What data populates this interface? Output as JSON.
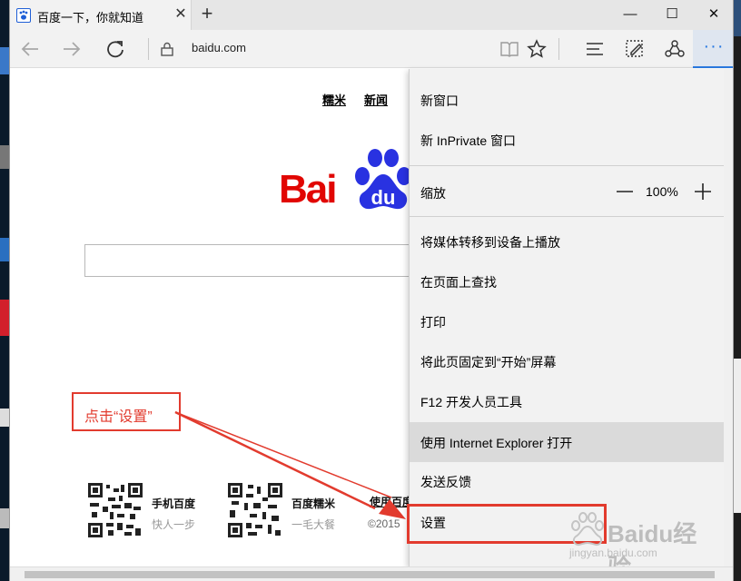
{
  "browser": {
    "tab_title": "百度一下，你就知道",
    "tab_close": "✕",
    "new_tab": "+",
    "minimize": "—",
    "maximize": "☐",
    "close": "✕",
    "address": "baidu.com",
    "more": "···"
  },
  "page": {
    "top_links": [
      "糯米",
      "新闻"
    ],
    "logo_text": "Bai",
    "logo_du": "du",
    "footer": [
      {
        "title": "手机百度",
        "sub": "快人一步"
      },
      {
        "title": "百度糯米",
        "sub": "一毛大餐"
      }
    ],
    "copyright": "©2015",
    "footer_partial": "使用百度前"
  },
  "menu": {
    "items": [
      {
        "label": "新窗口"
      },
      {
        "label": "新 InPrivate 窗口"
      },
      {
        "label": "缩放"
      },
      {
        "label": "将媒体转移到设备上播放"
      },
      {
        "label": "在页面上查找"
      },
      {
        "label": "打印"
      },
      {
        "label": "将此页固定到“开始”屏幕"
      },
      {
        "label": "F12 开发人员工具"
      },
      {
        "label": "使用 Internet Explorer 打开"
      },
      {
        "label": "发送反馈"
      },
      {
        "label": "设置"
      }
    ],
    "zoom_value": "100%"
  },
  "annotation": {
    "text": "点击“设置”",
    "color": "#e23b2e"
  },
  "watermark": {
    "main": "Baidu经验",
    "sub": "jingyan.baidu.com"
  },
  "colors": {
    "accent": "#2a7ae2",
    "baidu_red": "#e10602",
    "baidu_blue": "#2932e1",
    "highlight": "#e23b2e"
  }
}
